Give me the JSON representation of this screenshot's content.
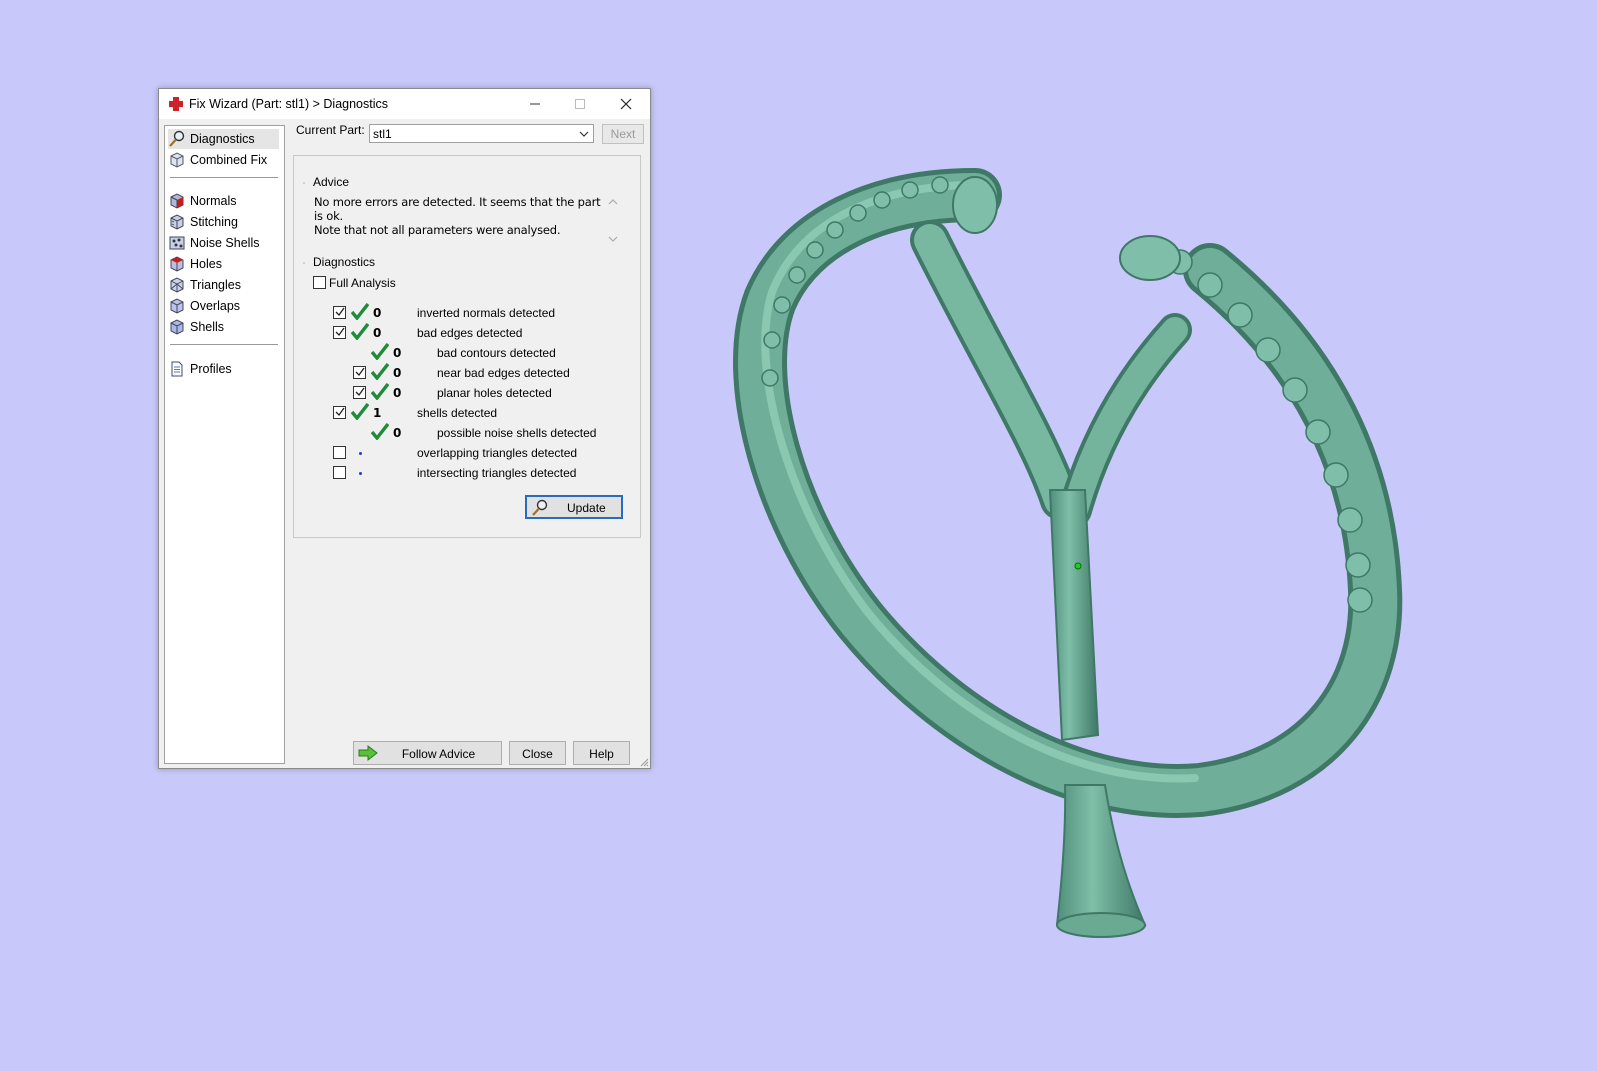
{
  "window": {
    "title": "Fix Wizard (Part: stl1) > Diagnostics"
  },
  "sidebar": {
    "items": [
      {
        "label": "Diagnostics",
        "icon": "magnifier-icon",
        "selected": true
      },
      {
        "label": "Combined Fix",
        "icon": "cube-icon"
      },
      {
        "label": "Normals",
        "icon": "normals-cube-icon"
      },
      {
        "label": "Stitching",
        "icon": "stitching-cube-icon"
      },
      {
        "label": "Noise Shells",
        "icon": "noise-shells-icon"
      },
      {
        "label": "Holes",
        "icon": "holes-cube-icon"
      },
      {
        "label": "Triangles",
        "icon": "triangles-cube-icon"
      },
      {
        "label": "Overlaps",
        "icon": "overlaps-cube-icon"
      },
      {
        "label": "Shells",
        "icon": "shells-cube-icon"
      },
      {
        "label": "Profiles",
        "icon": "document-icon"
      }
    ]
  },
  "current_part": {
    "label": "Current Part:",
    "value": "stl1",
    "next_label": "Next"
  },
  "advice": {
    "title": "Advice",
    "line1": "No more errors are detected. It seems that the part is ok.",
    "line2": "Note that not all parameters were analysed."
  },
  "diagnostics": {
    "title": "Diagnostics",
    "full_analysis_label": "Full Analysis",
    "full_analysis_checked": false,
    "rows": [
      {
        "count": "0",
        "label": "inverted normals detected",
        "checked": true,
        "status": "ok"
      },
      {
        "count": "0",
        "label": "bad edges detected",
        "checked": true,
        "status": "ok"
      },
      {
        "count": "0",
        "label": "bad contours detected",
        "status": "ok"
      },
      {
        "count": "0",
        "label": "near bad edges detected",
        "checked": true,
        "status": "ok"
      },
      {
        "count": "0",
        "label": "planar holes detected",
        "checked": true,
        "status": "ok"
      },
      {
        "count": "1",
        "label": "shells detected",
        "checked": true,
        "status": "ok"
      },
      {
        "count": "0",
        "label": "possible noise shells detected",
        "status": "ok"
      },
      {
        "count": "",
        "label": "overlapping triangles detected",
        "checked": false,
        "status": "not-analysed"
      },
      {
        "count": "",
        "label": "intersecting triangles detected",
        "checked": false,
        "status": "not-analysed"
      }
    ],
    "update_label": "Update"
  },
  "footer": {
    "follow_advice_label": "Follow Advice",
    "close_label": "Close",
    "help_label": "Help"
  },
  "colors": {
    "background": "#c8c8fa",
    "model": "#6fae98",
    "check_green": "#1e8c3a",
    "accent_blue": "#2a6bbd"
  }
}
